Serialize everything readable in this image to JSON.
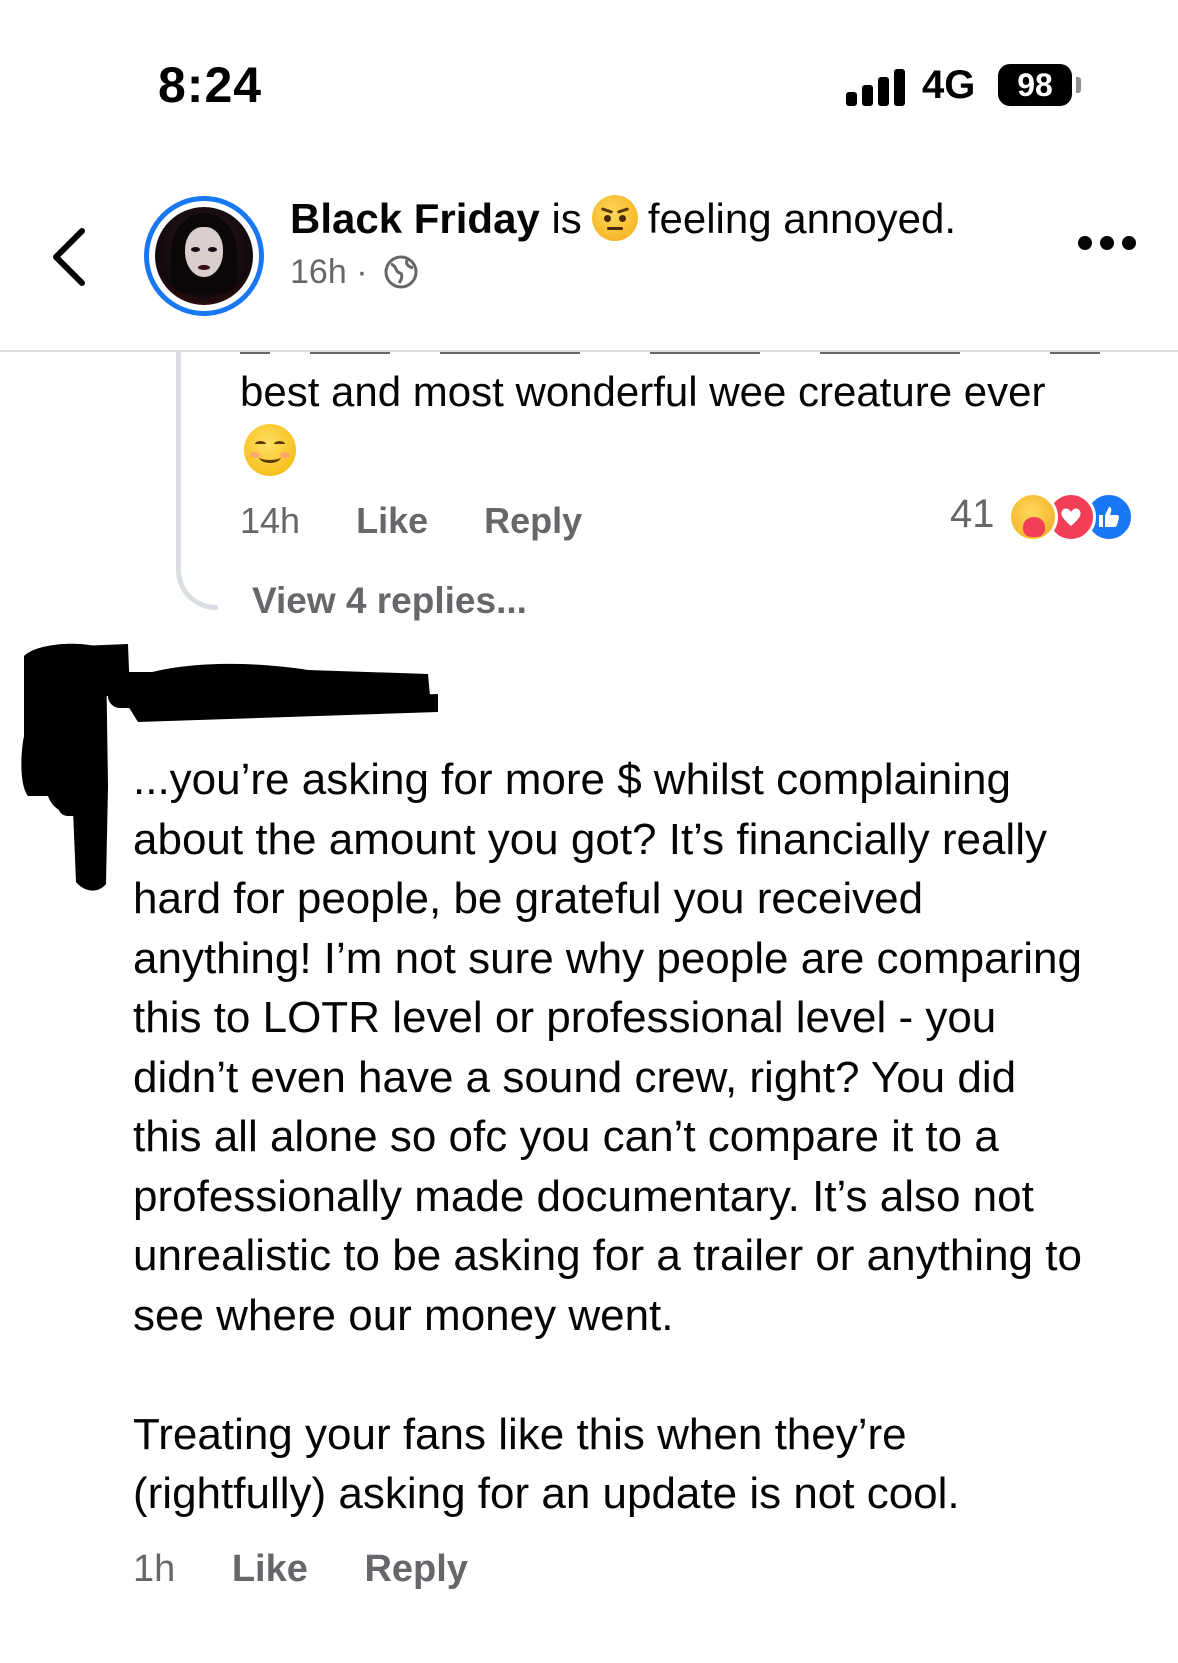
{
  "status_bar": {
    "time": "8:24",
    "network": "4G",
    "battery": "98"
  },
  "header": {
    "author": "Black Friday",
    "verb": "is",
    "feeling": "feeling annoyed.",
    "feeling_emoji": "angry-face-icon",
    "age": "16h",
    "separator": "·",
    "audience_icon": "globe-icon"
  },
  "previous_reply": {
    "text": "best and most wonderful wee creature ever",
    "emoji": "smiling-face-icon",
    "time": "14h",
    "like_label": "Like",
    "reply_label": "Reply",
    "reaction_count": "41",
    "reactions": [
      "care",
      "love",
      "like"
    ],
    "view_replies_label": "View 4 replies..."
  },
  "comment": {
    "author_redacted": true,
    "lines": [
      "...you’re asking for more $ whilst complaining",
      "about the amount you got? It’s financially really",
      "hard for people, be grateful you received",
      "anything! I’m not sure why people are comparing",
      "this to LOTR level or professional level - you",
      "didn’t even have a sound crew, right? You did",
      "this all alone so ofc you can’t compare it to a",
      "professionally made documentary. It’s also not",
      "unrealistic to be asking for a trailer or anything to",
      "see where our money went."
    ],
    "lines_2": [
      "Treating your fans like this when they’re",
      "(rightfully) asking for an update is not cool."
    ],
    "time": "1h",
    "like_label": "Like",
    "reply_label": "Reply"
  },
  "colors": {
    "accent": "#1877f2",
    "secondary_text": "#65676b",
    "divider": "#dadde1",
    "love": "#f33e58"
  }
}
